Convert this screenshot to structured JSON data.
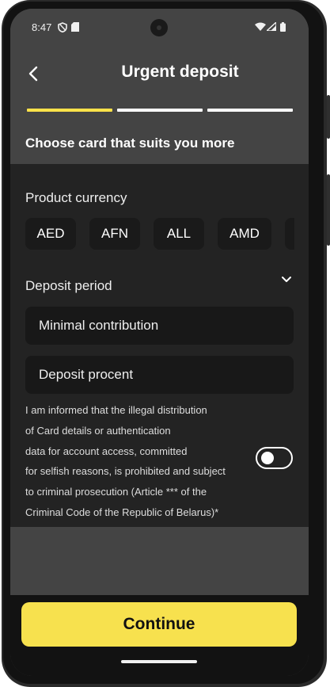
{
  "status_bar": {
    "time": "8:47",
    "icons": [
      "shield-icon",
      "sd-card-icon",
      "wifi-icon",
      "signal-icon",
      "battery-icon"
    ]
  },
  "header": {
    "back_icon": "chevron-left-icon",
    "title": "Urgent deposit",
    "steps": {
      "total": 3,
      "current": 1
    },
    "subtitle": "Choose card that suits you more"
  },
  "form": {
    "currency_label": "Product currency",
    "currencies": [
      "AED",
      "AFN",
      "ALL",
      "AMD",
      ""
    ],
    "period_label": "Deposit period",
    "period_icon": "chevron-down-icon",
    "min_contribution_placeholder": "Minimal contribution",
    "deposit_percent_placeholder": "Deposit procent",
    "consent_lines": [
      "I am informed that the illegal distribution",
      "of Card details or authentication",
      "data for account access, committed",
      "for selfish reasons, is prohibited and subject",
      "to criminal prosecution (Article *** of the",
      "Criminal Code of the Republic of Belarus)*"
    ],
    "consent_toggle_on": false
  },
  "footer": {
    "continue_label": "Continue"
  },
  "colors": {
    "accent": "#f7e14e",
    "background": "#232323",
    "header": "#444444"
  }
}
